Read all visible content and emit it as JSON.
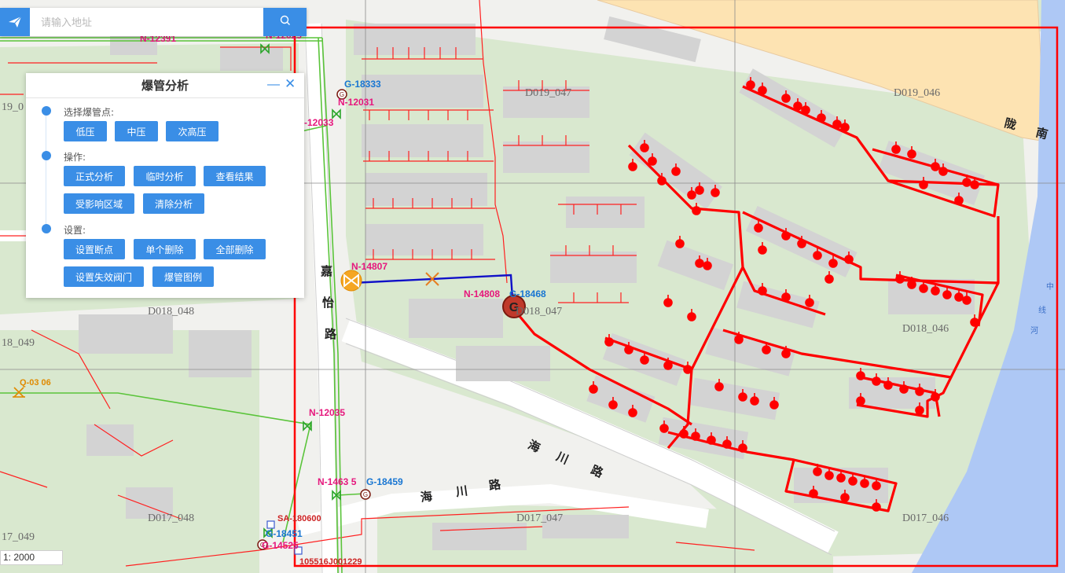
{
  "search": {
    "placeholder": "请输入地址"
  },
  "panel": {
    "title": "爆管分析",
    "section_select": "选择爆管点:",
    "btn_low": "低压",
    "btn_mid": "中压",
    "btn_sub_high": "次高压",
    "section_ops": "操作:",
    "btn_formal": "正式分析",
    "btn_temp": "临时分析",
    "btn_result": "查看结果",
    "btn_affected": "受影响区域",
    "btn_clear": "清除分析",
    "section_settings": "设置:",
    "btn_set_break": "设置断点",
    "btn_del_one": "单个删除",
    "btn_del_all": "全部删除",
    "btn_set_invalid": "设置失效阀门",
    "btn_legend": "爆管图例"
  },
  "scale": {
    "text": "1: 2000"
  },
  "map": {
    "sheets": {
      "d019_047": "D019_047",
      "d019_046": "D019_046",
      "d018_048": "D018_048",
      "d018_047": "D018_047",
      "d018_046": "D018_046",
      "d017_048": "D017_048",
      "d017_047": "D017_047",
      "d017_046": "D017_046",
      "s19_0": "19_0",
      "s18_049": "18_049",
      "s17_049": "17_049"
    },
    "roads": {
      "jiayi_1": "嘉",
      "jiayi_2": "怡",
      "jiayi_3": "路",
      "haichuan_a1": "海",
      "haichuan_a2": "川",
      "haichuan_a3": "路",
      "haichuan_b1": "海",
      "haichuan_b2": "川",
      "haichuan_b3": "路",
      "longnan_1": "陇",
      "longnan_2": "南",
      "river_1": "中",
      "river_2": "线",
      "river_3": "河"
    },
    "labels": {
      "n12391": "N-12391",
      "n12029": "N-12029",
      "g18333": "G-18333",
      "n12031": "N-12031",
      "n12033": "-12033",
      "n14807": "N-14807",
      "n14808": "N-14808",
      "g18468": "G-18468",
      "q0306": "Q-03 06",
      "n12035": "N-12035",
      "n14635": "N-1463 5",
      "g18459": "G-18459",
      "sa180600": "SA-180600",
      "g18451": "G-18451",
      "g14525": "G-14525",
      "code105516": "105516J001229"
    }
  },
  "colors": {
    "accent": "#3a8ee6",
    "pipe_red": "#ff0000",
    "pipe_green": "#5ac43a",
    "affected_blue": "#1010c8",
    "label_magenta": "#e6177d",
    "label_blue": "#1976d2",
    "river": "#aec8f5",
    "expressway": "#fde3b2"
  }
}
